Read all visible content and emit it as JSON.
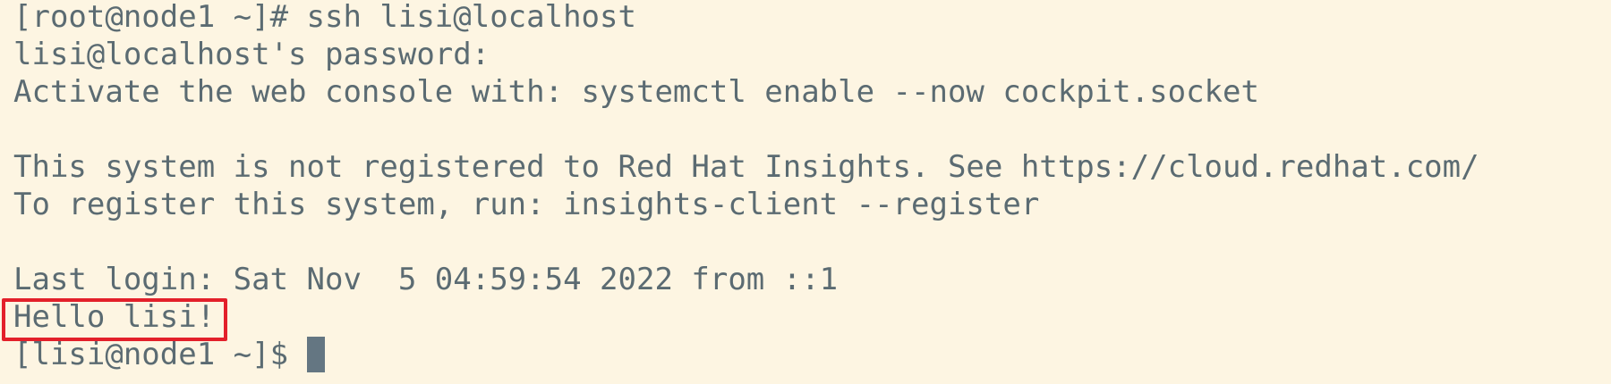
{
  "terminal": {
    "lines": [
      "[root@node1 ~]# ssh lisi@localhost",
      "lisi@localhost's password:",
      "Activate the web console with: systemctl enable --now cockpit.socket",
      "",
      "This system is not registered to Red Hat Insights. See https://cloud.redhat.com/",
      "To register this system, run: insights-client --register",
      "",
      "Last login: Sat Nov  5 04:59:54 2022 from ::1",
      "Hello lisi!"
    ],
    "prompt": "[lisi@node1 ~]$ "
  },
  "colors": {
    "background": "#fdf5e2",
    "text": "#5b6b72",
    "cursor": "#647682",
    "highlight": "#e3202a"
  }
}
